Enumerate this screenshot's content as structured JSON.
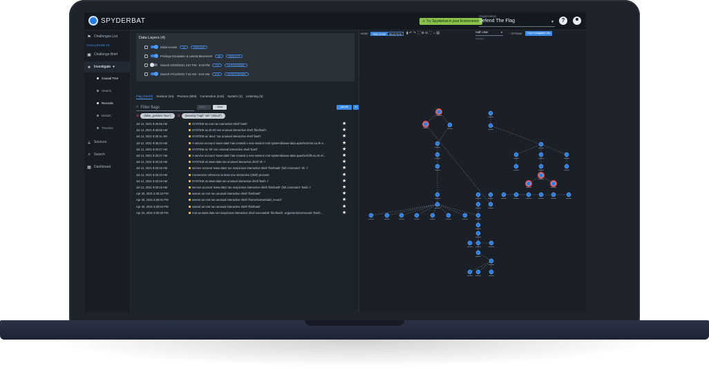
{
  "app": {
    "brand": "SPYDERBAT",
    "try_banner": "Try Spyderbat in your Environment",
    "org_label": "Organization",
    "org_value": "Defend The Flag",
    "help_glyph": "?"
  },
  "sidebar": {
    "items": [
      {
        "label": "Challenges List",
        "icon": "flag-icon"
      },
      {
        "label": "CHALLENGE 10",
        "icon": ""
      },
      {
        "label": "Challenge Brief",
        "icon": "briefcase-icon"
      },
      {
        "label": "Investigate",
        "icon": "star-icon"
      },
      {
        "label": "Causal Tree",
        "icon": "dot-icon"
      },
      {
        "label": "Search",
        "icon": "dot-icon"
      },
      {
        "label": "Records",
        "icon": "dot-icon"
      },
      {
        "label": "Details",
        "icon": "dot-icon"
      },
      {
        "label": "Timeline",
        "icon": "dot-icon"
      },
      {
        "label": "Sources",
        "icon": "plug-icon"
      },
      {
        "label": "Search",
        "icon": "search-icon"
      },
      {
        "label": "Dashboard",
        "icon": "grid-icon"
      }
    ]
  },
  "layers": {
    "title": "Data Layers (4)",
    "rows": [
      {
        "label": "Initial Access",
        "on": true,
        "pills": [
          "12",
          "RESULTS"
        ]
      },
      {
        "label": "Privilege Escalation & Lateral Movement",
        "on": true,
        "pills": [
          "36",
          "RESULTS"
        ]
      },
      {
        "label": "Search 04/30/2021 4:57 PM - 5:04 PM",
        "on": false,
        "pills": [
          "173",
          "IN PROGRESS"
        ]
      },
      {
        "label": "Search 07/12/2021 7:42 AM - 8:42 AM",
        "on": true,
        "pills": [
          "173",
          "24 PROCESSES"
        ]
      }
    ]
  },
  "tabs": [
    {
      "label": "Flag (19/43)",
      "active": true
    },
    {
      "label": "Session (44)",
      "active": false
    },
    {
      "label": "Process (804)",
      "active": false
    },
    {
      "label": "Connection (416)",
      "active": false
    },
    {
      "label": "System (2)",
      "active": false
    },
    {
      "label": "Listening (6)",
      "active": false
    }
  ],
  "filter": {
    "placeholder": "Filter flags",
    "clear": "Clear",
    "disabled_btn": "Apply",
    "add_all": "Add All",
    "caret": "▾"
  },
  "chips": [
    {
      "label": "(false_positive:\"true\")"
    },
    {
      "label": "(severity:\"high\" OR \"critical\")"
    }
  ],
  "records": [
    {
      "time": "Jul 12, 2021 9:40:56 AM",
      "msg": "SYSTEM as root ran interactive shell 'bash'"
    },
    {
      "time": "Jul 12, 2021 9:35:55 AM",
      "msg": "SYSTEM as uh-00 ran unusual interactive shell '/bin/bash'"
    },
    {
      "time": "Jul 12, 2021 9:35:11 AM",
      "msg": "SYSTEM as 'dev1' ran unusual interactive shell 'bash'"
    },
    {
      "time": "Jul 12, 2021 9:35:34 AM",
      "msg": "A service account 'www-data' has created a new session root systemd/www-data apache2/root.su.sh e..."
    },
    {
      "time": "Jul 12, 2021 9:33:27 AM",
      "msg": "SYSTEM as 'sh' ran unusual interactive shell 'bash'"
    },
    {
      "time": "Jul 12, 2021 9:33:27 AM",
      "msg": "A service account 'www-data' has created a new session root systemd/www-data apache2/dfs.su.sh ef..."
    },
    {
      "time": "Jul 12, 2021 9:33:16 AM",
      "msg": "SYSTEM as www-data ran unusual interactive shell 'sh -i'"
    },
    {
      "time": "Jul 12, 2021 9:33:15 AM",
      "msg": "service account 'www-data' ran suspicious interactive shell '/bin/bash' (full command: 'sh -i'"
    },
    {
      "time": "Jul 12, 2021 9:33:10 AM",
      "msg": "Connection reference at least one interactive (shell) process"
    },
    {
      "time": "Jul 12, 2021 9:33:16 AM",
      "msg": "SYSTEM as www-data ran unusual interactive shell 'bash -i'"
    },
    {
      "time": "Jul 12, 2021 9:33:16 AM",
      "msg": "service account 'www-data' ran suspicious interactive shell '/bin/bash' (full command: 'bash -i'"
    },
    {
      "time": "Apr 30, 2021 5:30:10 PM",
      "msg": "sosnet as root ran unusual interactive shell '/bin/bash'"
    },
    {
      "time": "Apr 30, 2021 5:28:04 PM",
      "msg": "sosnet as root ran unusual interactive shell '/home/sosnet/add_record'"
    },
    {
      "time": "Apr 30, 2021 5:28:04 PM",
      "msg": "sosnet as root ran unusual interactive shell '/bin/bash'"
    },
    {
      "time": "Apr 22, 2021 5:00:30 PM",
      "msg": "root as www-data ran suspicious interactive shell executable '/bin/bash', arguments/command '/bin/b..."
    }
  ],
  "graph_toolbar": {
    "mode_label": "MODE:",
    "mode_a": "TREE ZOOM",
    "mode_b": "SELECTION",
    "auth_user": "Auth User",
    "highlight": "Highlight",
    "options": "OPTIONS",
    "copy_link": "Copy Investigation Link"
  },
  "colors": {
    "accent": "#3c8ce8",
    "node": "#2a7de1",
    "node_alert": "#e2534f",
    "banner": "#8bc34a"
  }
}
